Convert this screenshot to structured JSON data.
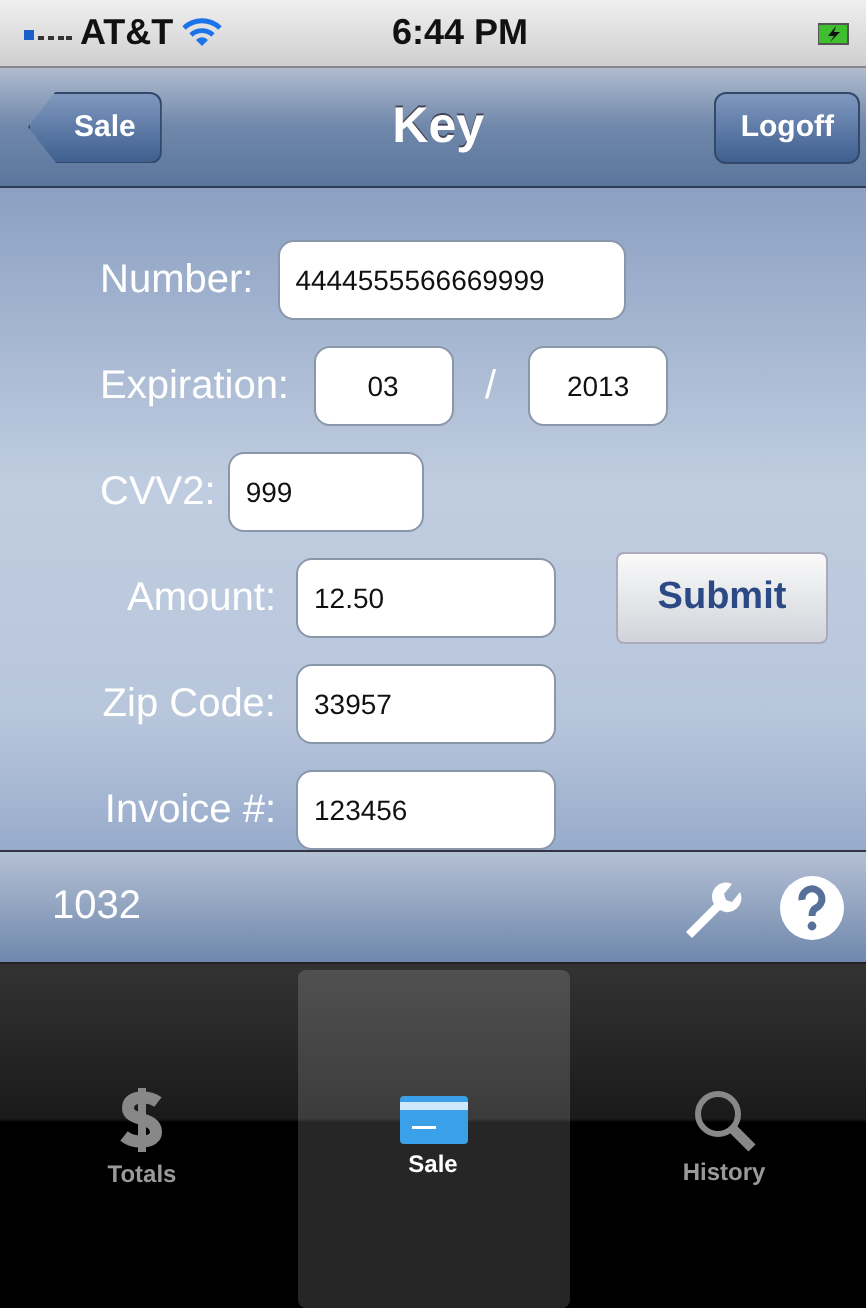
{
  "status_bar": {
    "carrier": "AT&T",
    "time": "6:44 PM"
  },
  "nav_bar": {
    "back_button": "Sale",
    "title": "Key",
    "right_button": "Logoff"
  },
  "form": {
    "fields": [
      {
        "kind": "text",
        "label": "Number:",
        "value": "4444555566669999"
      },
      {
        "kind": "expiry",
        "label": "Expiration:",
        "month": "03",
        "separator": "/",
        "year": "2013"
      },
      {
        "kind": "text",
        "label": "CVV2:",
        "value": "999"
      },
      {
        "kind": "text",
        "label": "Amount:",
        "value": "12.50",
        "button": "Submit"
      },
      {
        "kind": "text",
        "label": "Zip Code:",
        "value": "33957"
      },
      {
        "kind": "text",
        "label": "Invoice #:",
        "value": "123456"
      }
    ]
  },
  "bottom_bar": {
    "id": "1032"
  },
  "tabs": [
    {
      "label": "Totals",
      "kind": "dollar",
      "selected": false
    },
    {
      "label": "Sale",
      "kind": "card",
      "selected": true
    },
    {
      "label": "History",
      "kind": "search",
      "selected": false
    }
  ]
}
